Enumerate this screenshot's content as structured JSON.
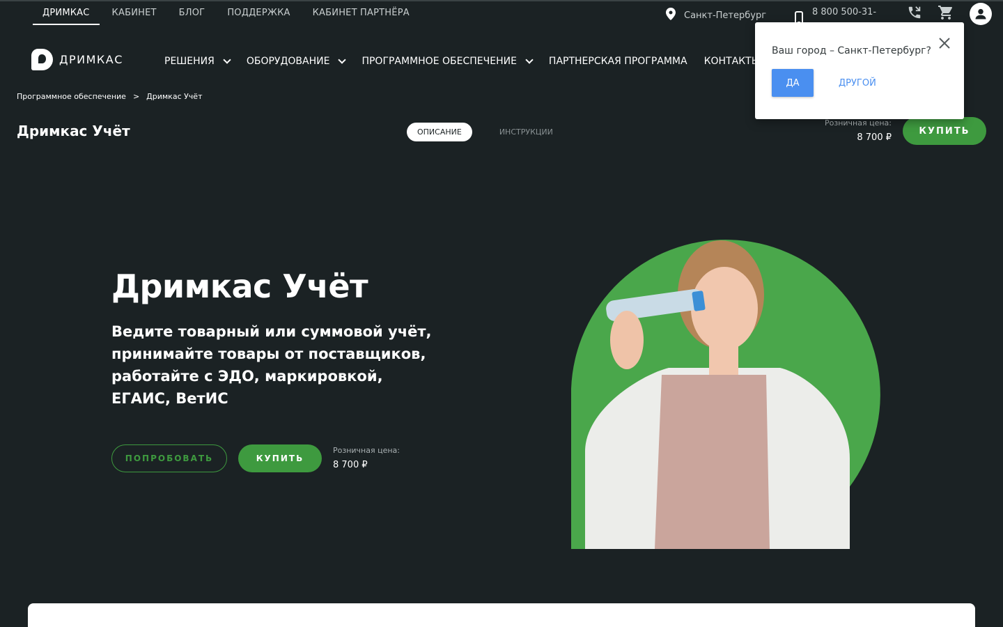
{
  "top_nav": {
    "items": [
      {
        "label": "ДРИМКАС",
        "active": true
      },
      {
        "label": "КАБИНЕТ",
        "active": false
      },
      {
        "label": "БЛОГ",
        "active": false
      },
      {
        "label": "ПОДДЕРЖКА",
        "active": false
      },
      {
        "label": "КАБИНЕТ ПАРТНЁРА",
        "active": false
      }
    ],
    "city": "Санкт-Петербург",
    "phone": "8 800 500-31-",
    "icons": [
      "location-pin-icon",
      "mobile-phone-icon",
      "phone-callback-icon",
      "cart-icon",
      "account-icon"
    ]
  },
  "main_nav": {
    "logo_text": "ДРИМКАС",
    "items": [
      {
        "label": "РЕШЕНИЯ",
        "dropdown": true
      },
      {
        "label": "ОБОРУДОВАНИЕ",
        "dropdown": true
      },
      {
        "label": "ПРОГРАММНОЕ ОБЕСПЕЧЕНИЕ",
        "dropdown": true
      },
      {
        "label": "ПАРТНЕРСКАЯ ПРОГРАММА",
        "dropdown": false
      },
      {
        "label": "КОНТАКТЫ",
        "dropdown": false
      }
    ]
  },
  "breadcrumb": {
    "items": [
      "Программное обеспечение",
      "Дримкас Учёт"
    ],
    "separator": ">"
  },
  "product_bar": {
    "title": "Дримкас Учёт",
    "tabs": [
      {
        "label": "ОПИСАНИЕ",
        "active": true
      },
      {
        "label": "ИНСТРУКЦИИ",
        "active": false
      }
    ],
    "price_label": "Розничная цена:",
    "price": "8 700 ₽",
    "buy_label": "КУПИТЬ"
  },
  "hero": {
    "title": "Дримкас Учёт",
    "subtitle": "Ведите товарный или суммовой учёт, принимайте товары от поставщиков, работайте с ЭДО, маркировкой, ЕГАИС, ВетИС",
    "try_label": "ПОПРОБОВАТЬ",
    "buy_label": "КУПИТЬ",
    "price_label": "Розничная цена:",
    "price": "8 700 ₽"
  },
  "city_popup": {
    "question": "Ваш город – Санкт-Петербург?",
    "yes_label": "ДА",
    "other_label": "ДРУГОЙ"
  },
  "colors": {
    "background": "#1b2224",
    "accent_green": "#3e9a3f",
    "popup_blue": "#4a8ff0",
    "white": "#ffffff"
  }
}
